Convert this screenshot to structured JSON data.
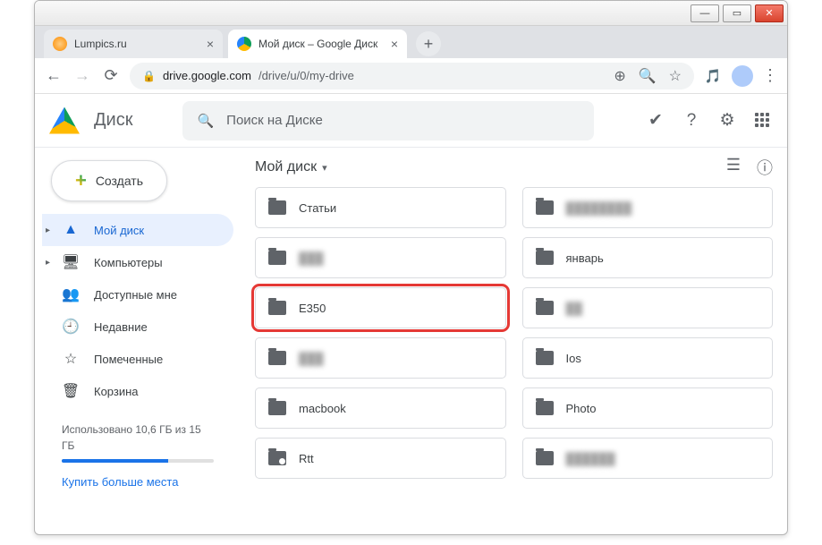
{
  "window": {
    "tabs": [
      {
        "title": "Lumpics.ru",
        "active": false
      },
      {
        "title": "Мой диск – Google Диск",
        "active": true
      }
    ]
  },
  "addressbar": {
    "host": "drive.google.com",
    "path": "/drive/u/0/my-drive"
  },
  "drive": {
    "product_name": "Диск",
    "search_placeholder": "Поиск на Диске",
    "create_label": "Создать",
    "breadcrumb": "Мой диск"
  },
  "sidebar": {
    "items": [
      {
        "icon": "drive-icon",
        "label": "Мой диск",
        "expandable": true,
        "active": true
      },
      {
        "icon": "computers-icon",
        "label": "Компьютеры",
        "expandable": true
      },
      {
        "icon": "shared-icon",
        "label": "Доступные мне"
      },
      {
        "icon": "recent-icon",
        "label": "Недавние"
      },
      {
        "icon": "starred-icon",
        "label": "Помеченные"
      },
      {
        "icon": "trash-icon",
        "label": "Корзина"
      }
    ],
    "storage_text": "Использовано 10,6 ГБ из 15 ГБ",
    "storage_percent": 70,
    "buy_more": "Купить больше места"
  },
  "folders": [
    {
      "name": "Статьи",
      "col": 1
    },
    {
      "name": "████████",
      "col": 2,
      "blur": true
    },
    {
      "name": "███",
      "col": 1,
      "blur": true
    },
    {
      "name": "январь",
      "col": 2
    },
    {
      "name": "E350",
      "col": 1,
      "highlight": true
    },
    {
      "name": "██",
      "col": 2,
      "blur": true
    },
    {
      "name": "███",
      "col": 1,
      "blur": true
    },
    {
      "name": "Ios",
      "col": 2
    },
    {
      "name": "macbook",
      "col": 1
    },
    {
      "name": "Photo",
      "col": 2
    },
    {
      "name": "Rtt",
      "col": 1,
      "shared": true
    },
    {
      "name": "██████",
      "col": 2,
      "blur": true
    }
  ]
}
